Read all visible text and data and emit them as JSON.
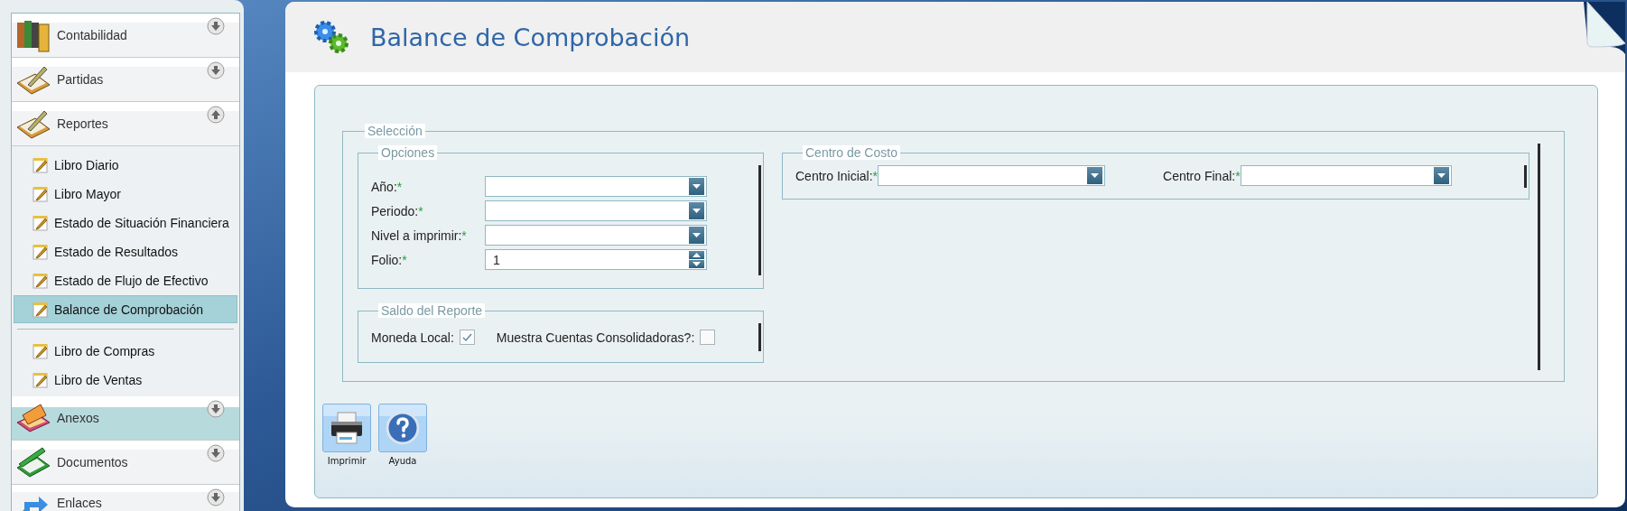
{
  "sidebar": {
    "sections": [
      {
        "label": "Contabilidad",
        "expanded": false,
        "selected": false
      },
      {
        "label": "Partidas",
        "expanded": false,
        "selected": false
      },
      {
        "label": "Reportes",
        "expanded": true,
        "selected": false,
        "item_groups": [
          {
            "items": [
              {
                "label": "Libro Diario",
                "selected": false
              },
              {
                "label": "Libro Mayor",
                "selected": false
              },
              {
                "label": "Estado de Situación Financiera",
                "selected": false
              },
              {
                "label": "Estado de Resultados",
                "selected": false
              },
              {
                "label": "Estado de Flujo de Efectivo",
                "selected": false
              },
              {
                "label": "Balance de Comprobación",
                "selected": true
              }
            ]
          },
          {
            "items": [
              {
                "label": "Libro de Compras",
                "selected": false
              },
              {
                "label": "Libro de Ventas",
                "selected": false
              }
            ]
          }
        ]
      },
      {
        "label": "Anexos",
        "expanded": false,
        "selected": true
      },
      {
        "label": "Documentos",
        "expanded": false,
        "selected": false
      },
      {
        "label": "Enlaces",
        "expanded": false,
        "selected": false
      }
    ]
  },
  "page": {
    "title": "Balance de Comprobación",
    "selection": {
      "legend": "Selección",
      "options": {
        "legend": "Opciones",
        "fields": [
          {
            "label": "Año:",
            "required_mark": "*",
            "kind": "dropdown"
          },
          {
            "label": "Periodo:",
            "required_mark": "*",
            "kind": "dropdown"
          },
          {
            "label": "Nivel a imprimir:",
            "required_mark": "*",
            "kind": "dropdown"
          },
          {
            "label": "Folio:",
            "required_mark": "*",
            "kind": "spinner",
            "value": "1"
          }
        ]
      },
      "balance": {
        "legend": "Saldo del Reporte",
        "checkboxes": [
          {
            "label": "Moneda Local:",
            "checked": true
          },
          {
            "label": "Muestra Cuentas Consolidadoras?:",
            "checked": false
          }
        ]
      },
      "cost_center": {
        "legend": "Centro de Costo",
        "fields": [
          {
            "label": "Centro Inicial:",
            "required_mark": "*",
            "kind": "dropdown"
          },
          {
            "label": "Centro Final:",
            "required_mark": "*",
            "kind": "dropdown"
          }
        ]
      }
    },
    "buttons": [
      {
        "label": "Imprimir",
        "kind": "print"
      },
      {
        "label": "Ayuda",
        "kind": "help"
      }
    ]
  }
}
